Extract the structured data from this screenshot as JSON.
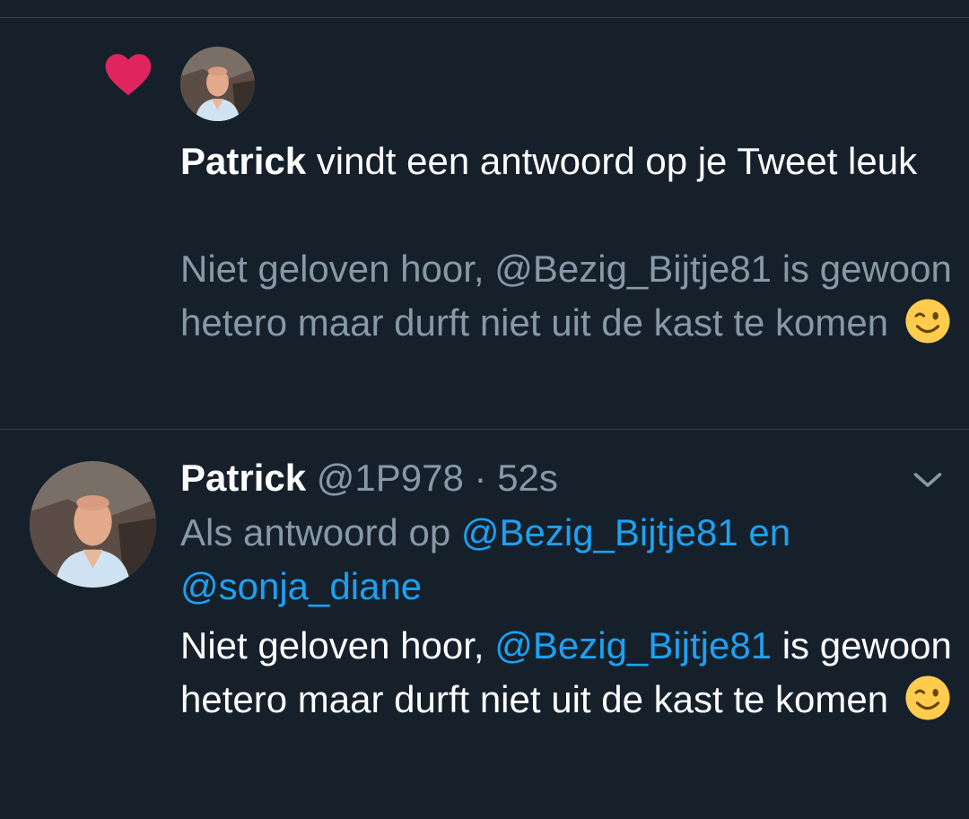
{
  "notification": {
    "icon": "heart-icon",
    "icon_color": "#e0245e",
    "actor_name": "Patrick",
    "action_text": " vindt een antwoord op je Tweet leuk",
    "quote_before": "Niet geloven hoor, ",
    "quote_mention": "@Bezig_Bijtje81",
    "quote_after": " is gewoon hetero maar durft niet uit de kast te komen "
  },
  "tweet": {
    "name": "Patrick",
    "handle": "@1P978",
    "separator": " · ",
    "time": "52s",
    "reply_prefix": "Als antwoord op ",
    "reply_mention_1": "@Bezig_Bijtje81",
    "reply_joiner": " en",
    "reply_mention_2": "@sonja_diane",
    "body_before": "Niet geloven hoor, ",
    "body_mention": "@Bezig_Bijtje81",
    "body_after": " is gewoon hetero maar durft niet uit de kast te komen ",
    "menu_icon": "chevron-down-icon"
  },
  "colors": {
    "background": "#15202b",
    "divider": "#38444d",
    "secondary_text": "#8899a6",
    "link": "#1da1f2",
    "like": "#e0245e"
  }
}
